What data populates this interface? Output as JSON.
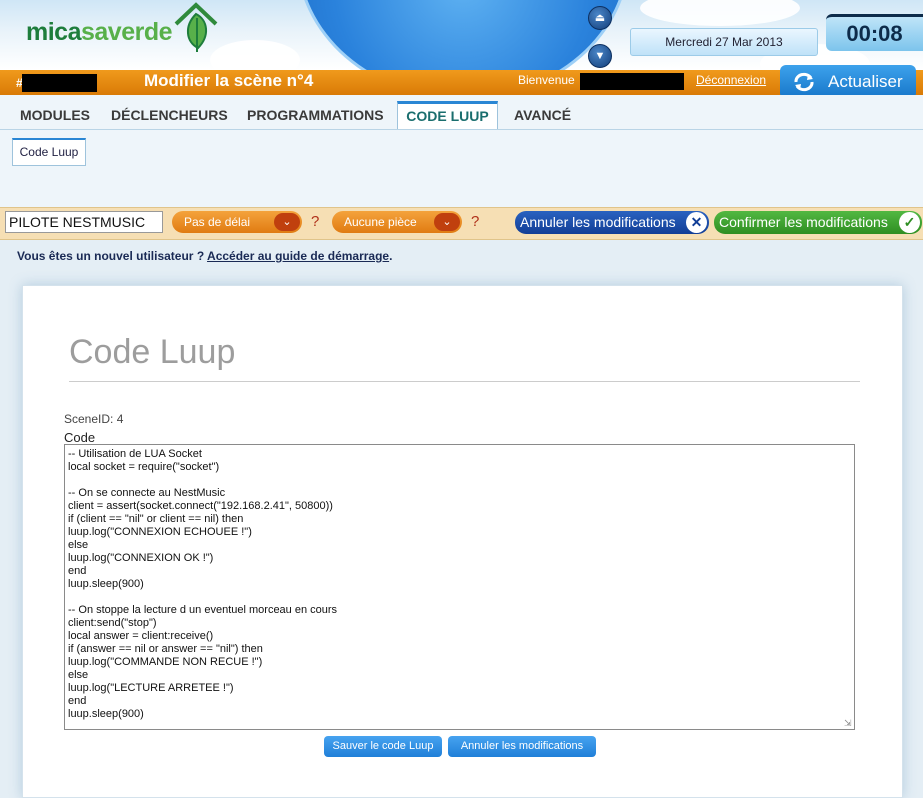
{
  "brand": {
    "part1": "mica",
    "part2": "saverde",
    "logo_icon": "house-leaf-icon"
  },
  "header": {
    "date": "Mercredi 27 Mar 2013",
    "time": "00:08",
    "scene_title": "Modifier la scène n°4",
    "hash_prefix": "#",
    "welcome": "Bienvenue",
    "logout": "Déconnexion",
    "refresh_label": "Actualiser",
    "refresh_icon": "refresh-icon",
    "orb_up_icon": "eject-up-icon",
    "orb_down_icon": "arrow-down-icon"
  },
  "tabs": [
    {
      "label": "MODULES"
    },
    {
      "label": "DÉCLENCHEURS"
    },
    {
      "label": "PROGRAMMATIONS"
    },
    {
      "label": "CODE LUUP",
      "active": true
    },
    {
      "label": "AVANCÉ"
    }
  ],
  "subtab": {
    "label": "Code Luup"
  },
  "scene_bar": {
    "name_value": "PILOTE NESTMUSIC",
    "delay_select": "Pas de délai",
    "room_select": "Aucune pièce",
    "help_mark": "?",
    "cancel_label": "Annuler les modifications",
    "confirm_label": "Confirmer les modifications"
  },
  "new_user": {
    "text": "Vous êtes un nouvel utilisateur ? ",
    "link": "Accéder au guide de démarrage",
    "suffix": "."
  },
  "panel": {
    "title": "Code Luup",
    "scene_id_label": "SceneID:",
    "scene_id_value": "4",
    "code_label": "Code",
    "code": "-- Utilisation de LUA Socket\nlocal socket = require(\"socket\")\n\n-- On se connecte au NestMusic\nclient = assert(socket.connect(\"192.168.2.41\", 50800))\nif (client == \"nil\" or client == nil) then\nluup.log(\"CONNEXION ECHOUEE !\")\nelse\nluup.log(\"CONNEXION OK !\")\nend\nluup.sleep(900)\n\n-- On stoppe la lecture d un eventuel morceau en cours\nclient:send(\"stop\")\nlocal answer = client:receive()\nif (answer == nil or answer == \"nil\") then\nluup.log(\"COMMANDE NON RECUE !\")\nelse\nluup.log(\"LECTURE ARRETEE !\")\nend\nluup.sleep(900)",
    "save_button": "Sauver le code Luup",
    "cancel_button": "Annuler les modifications"
  },
  "colors": {
    "orange_bar": "#e0820a",
    "accent_blue": "#2a86d4",
    "confirm_green": "#3a9c2a",
    "cancel_blue": "#1a4aa8"
  }
}
